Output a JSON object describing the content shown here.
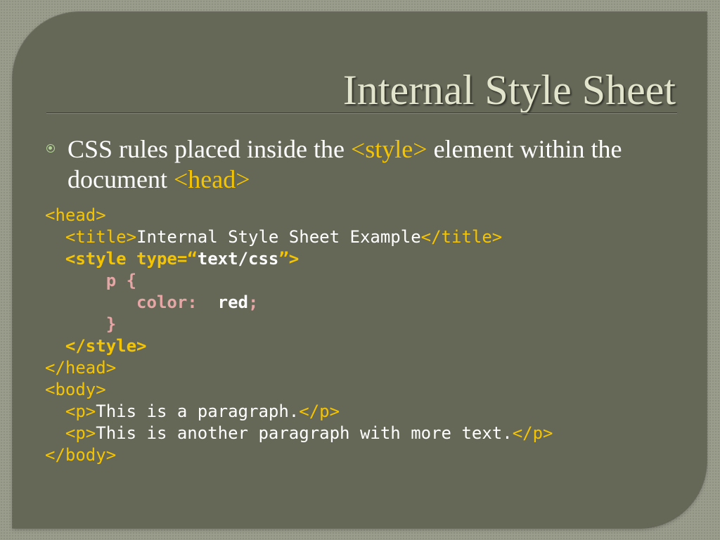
{
  "title": "Internal Style Sheet",
  "bullet": {
    "text_1": "CSS rules placed inside the ",
    "highlight_1": "<style>",
    "text_2": " element within the document ",
    "highlight_2": "<head>"
  },
  "code": {
    "head_open": "<head>",
    "title_open": "<title>",
    "title_text": "Internal Style Sheet Example",
    "title_close": "</title>",
    "style_open_start": "<style type=“",
    "style_type_value": "text/css",
    "style_open_end": "”>",
    "selector": "p {",
    "property": "color:",
    "property_value": "red",
    "semicolon": ";",
    "brace_close": "}",
    "style_close": "</style>",
    "head_close": "</head>",
    "body_open": "<body>",
    "p_open_1": "<p>",
    "p_text_1": "This is a paragraph.",
    "p_close_1": "</p>",
    "p_open_2": "<p>",
    "p_text_2": "This is another paragraph with more text.",
    "p_close_2": "</p>",
    "body_close": "</body>"
  },
  "colors": {
    "background": "#9a9c8c",
    "panel": "#656757",
    "title": "#e2e4cc",
    "body_text": "#ffffff",
    "highlight": "#f5c400",
    "css_syntax": "#e7a6a6",
    "bullet": "#b3d496"
  },
  "icons": {
    "bullet": "circle-bullet-icon"
  }
}
